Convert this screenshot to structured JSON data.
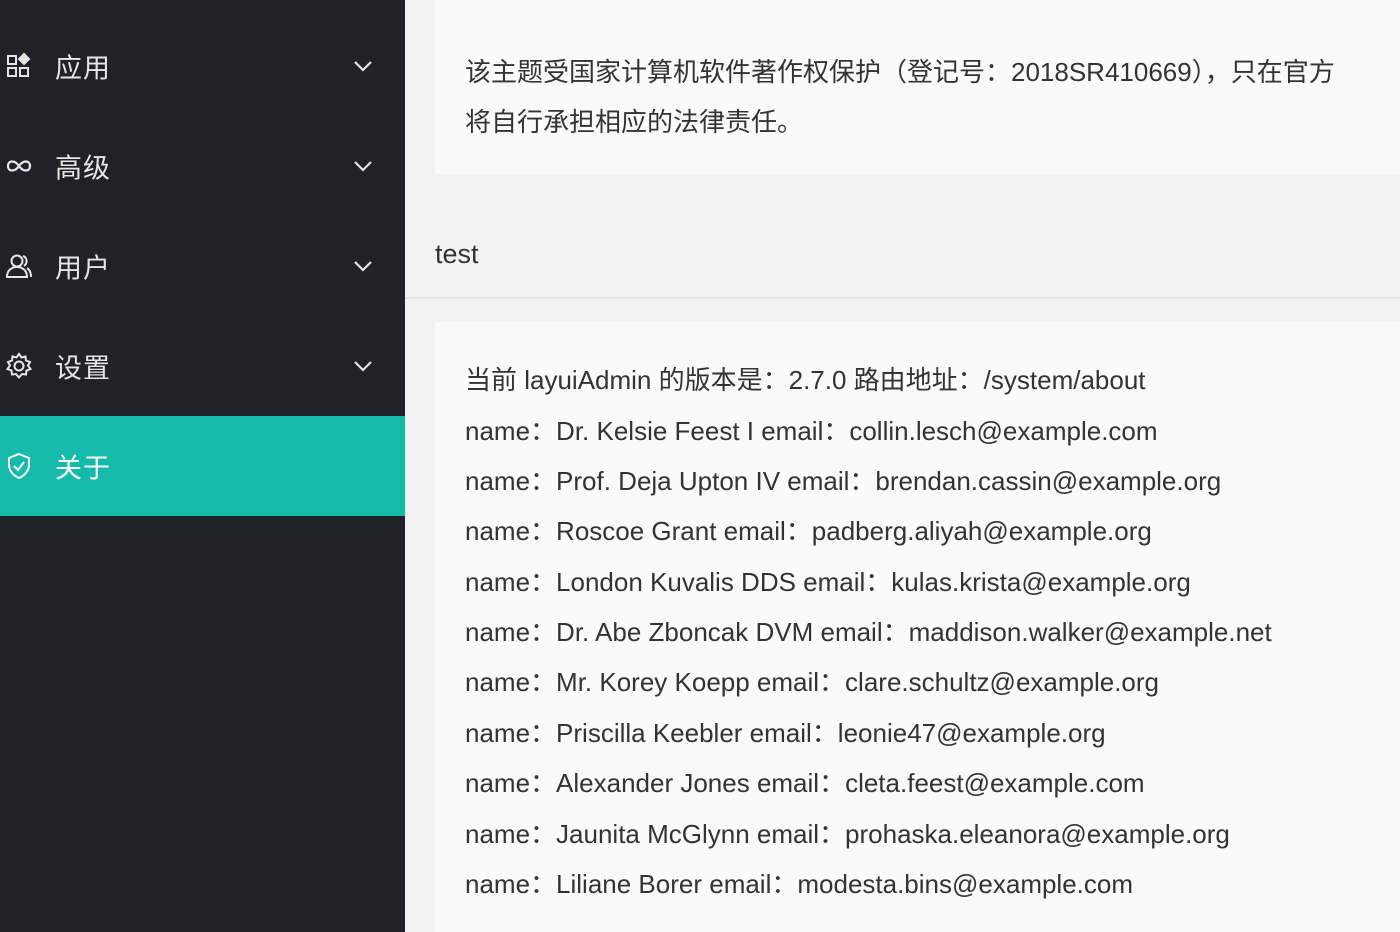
{
  "sidebar": {
    "items": [
      {
        "label": "应用",
        "icon": "app-grid-icon",
        "has_arrow": true,
        "active": false
      },
      {
        "label": "高级",
        "icon": "infinity-icon",
        "has_arrow": true,
        "active": false
      },
      {
        "label": "用户",
        "icon": "user-icon",
        "has_arrow": true,
        "active": false
      },
      {
        "label": "设置",
        "icon": "gear-icon",
        "has_arrow": true,
        "active": false
      },
      {
        "label": "关于",
        "icon": "shield-check-icon",
        "has_arrow": false,
        "active": true
      }
    ],
    "background_color": "#20222a",
    "active_color": "#16baaa"
  },
  "notice": {
    "line1": "该主题受国家计算机软件著作权保护（登记号：2018SR410669），只在官方",
    "line2": "将自行承担相应的法律责任。"
  },
  "section": {
    "title": "test"
  },
  "info": {
    "version_line": "当前 layuiAdmin 的版本是：2.7.0 路由地址：/system/about",
    "users": [
      "name：Dr. Kelsie Feest I email：collin.lesch@example.com",
      "name：Prof. Deja Upton IV email：brendan.cassin@example.org",
      "name：Roscoe Grant email：padberg.aliyah@example.org",
      "name：London Kuvalis DDS email：kulas.krista@example.org",
      "name：Dr. Abe Zboncak DVM email：maddison.walker@example.net",
      "name：Mr. Korey Koepp email：clare.schultz@example.org",
      "name：Priscilla Keebler email：leonie47@example.org",
      "name：Alexander Jones email：cleta.feest@example.com",
      "name：Jaunita McGlynn email：prohaska.eleanora@example.org",
      "name：Liliane Borer email：modesta.bins@example.com"
    ]
  }
}
